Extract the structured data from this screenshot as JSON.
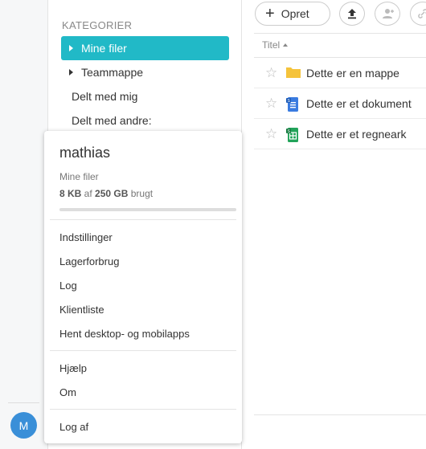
{
  "sidebar": {
    "category_label": "KATEGORIER",
    "items": [
      {
        "label": "Mine filer"
      },
      {
        "label": "Teammappe"
      },
      {
        "label": "Delt med mig"
      },
      {
        "label": "Delt med andre:"
      }
    ]
  },
  "toolbar": {
    "create_label": "Opret",
    "create_icon": "plus-icon",
    "upload_icon": "upload-icon",
    "add_user_icon": "add-user-icon",
    "link_icon": "link-icon"
  },
  "file_list": {
    "column_title": "Titel",
    "files": [
      {
        "name": "Dette er en mappe",
        "icon": "folder-icon"
      },
      {
        "name": "Dette er et dokument",
        "icon": "document-icon"
      },
      {
        "name": "Dette er et regneark",
        "icon": "spreadsheet-icon"
      }
    ]
  },
  "account_menu": {
    "username": "mathias",
    "storage_label": "Mine filer",
    "usage_used": "8 KB",
    "usage_mid": " af ",
    "usage_total": "250 GB",
    "usage_suffix": " brugt",
    "usage_fraction": 0.0,
    "menu_items": [
      {
        "label": "Indstillinger"
      },
      {
        "label": "Lagerforbrug"
      },
      {
        "label": "Log"
      },
      {
        "label": "Klientliste"
      },
      {
        "label": "Hent desktop- og mobilapps"
      }
    ],
    "help_items": [
      {
        "label": "Hjælp"
      },
      {
        "label": "Om"
      }
    ],
    "logout_label": "Log af"
  },
  "avatar": {
    "initial": "M"
  },
  "colors": {
    "accent": "#21b9c7",
    "avatar": "#3a8fd8",
    "folder": "#f5c33b",
    "document": "#3a7be0",
    "spreadsheet": "#22a35a"
  }
}
